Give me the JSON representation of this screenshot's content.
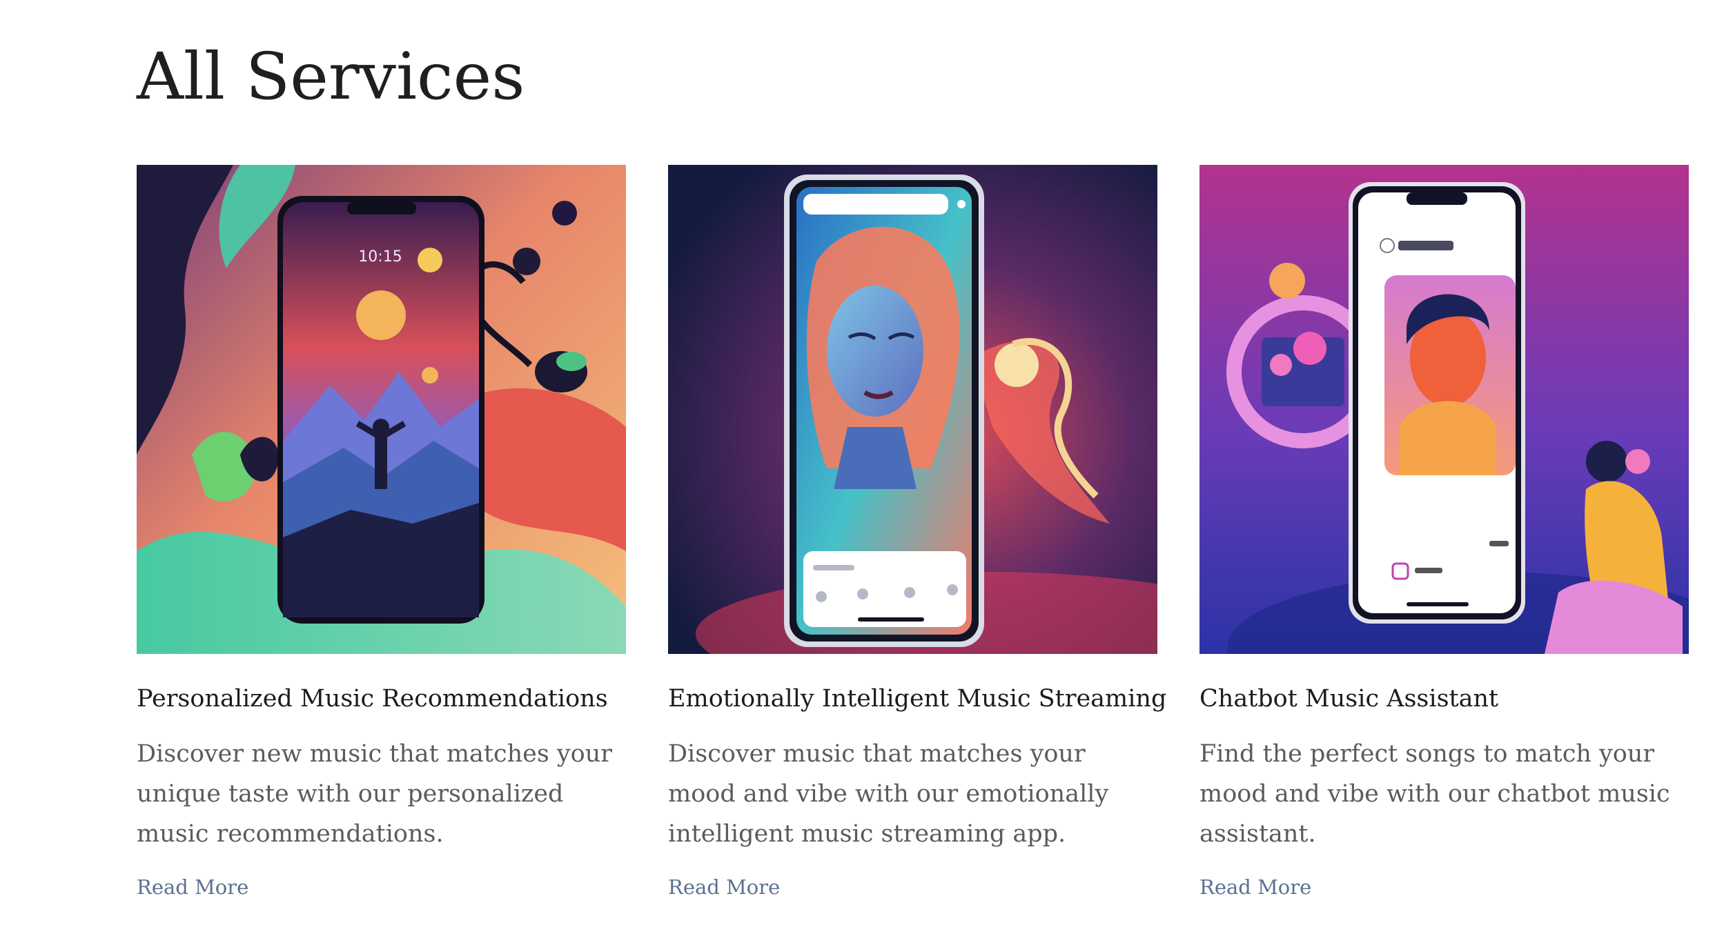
{
  "page": {
    "title": "All Services"
  },
  "services": [
    {
      "title": "Personalized Music Recommendations",
      "description": "Discover new music that matches your unique taste with our personalized music recommendations.",
      "link_label": "Read More",
      "image": {
        "subject": "smartphone-mountain-illustration",
        "phone_time": "10:15"
      }
    },
    {
      "title": "Emotionally Intelligent Music Streaming",
      "description": "Discover music that matches your mood and vibe with our emotionally intelligent music streaming app.",
      "link_label": "Read More",
      "image": {
        "subject": "smartphone-woman-portrait-illustration"
      }
    },
    {
      "title": "Chatbot Music Assistant",
      "description": "Find the perfect songs to match your mood and vibe with our chatbot music assistant.",
      "link_label": "Read More",
      "image": {
        "subject": "smartphone-chatbot-avatar-illustration"
      }
    }
  ],
  "colors": {
    "title": "#1f1f1f",
    "body_text": "#5b5b5b",
    "link": "#5a7190",
    "background": "#ffffff"
  }
}
